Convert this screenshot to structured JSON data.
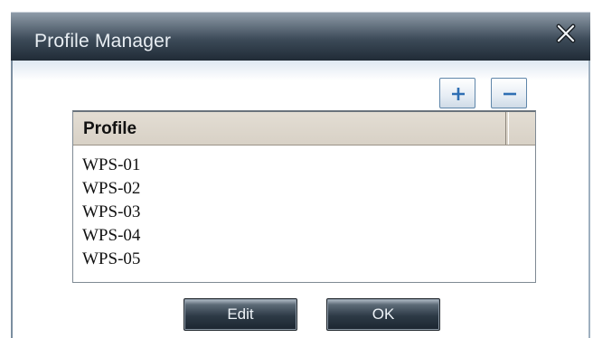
{
  "window": {
    "title": "Profile Manager"
  },
  "toolbar": {
    "add_icon": "plus-icon",
    "remove_icon": "minus-icon"
  },
  "list": {
    "columns": [
      "Profile"
    ],
    "rows": [
      "WPS-01",
      "WPS-02",
      "WPS-03",
      "WPS-04",
      "WPS-05"
    ]
  },
  "actions": {
    "edit_label": "Edit",
    "ok_label": "OK"
  },
  "colors": {
    "titlebar": "#3c4a58",
    "header_bg": "#d8d1c6",
    "button_dark": "#2d3a46",
    "accent_icon": "#2f6fb3"
  }
}
